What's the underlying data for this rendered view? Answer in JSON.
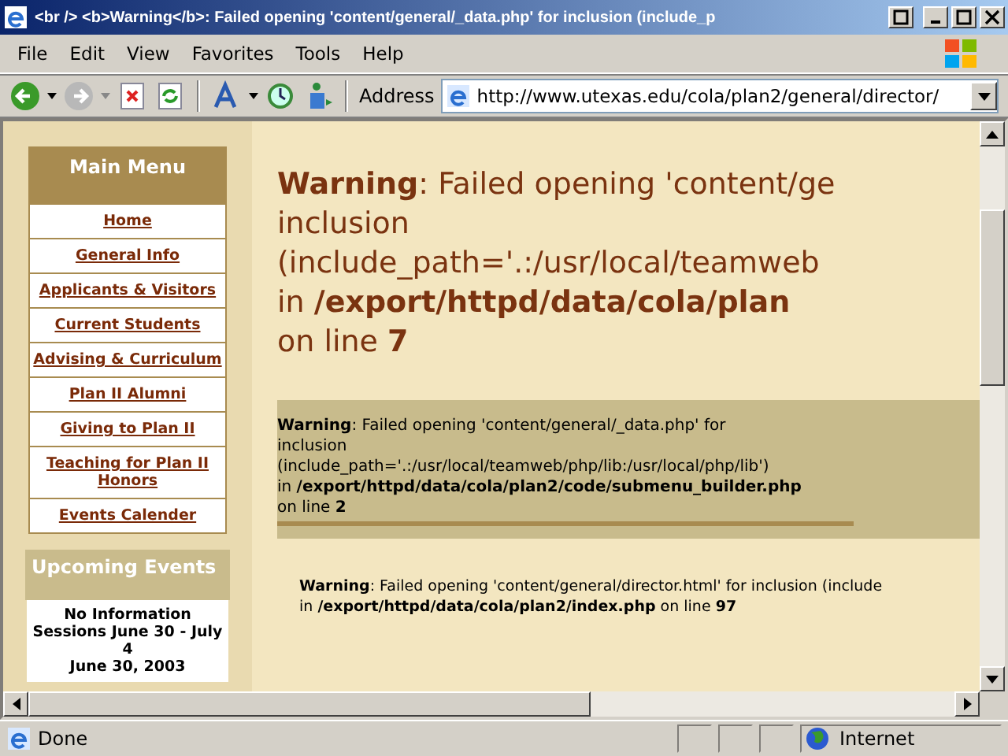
{
  "window": {
    "title": "<br /> <b>Warning</b>: Failed opening 'content/general/_data.php' for inclusion (include_p"
  },
  "menu": [
    "File",
    "Edit",
    "View",
    "Favorites",
    "Tools",
    "Help"
  ],
  "address": {
    "label": "Address",
    "value": "http://www.utexas.edu/cola/plan2/general/director/"
  },
  "sidebar": {
    "title": "Main Menu",
    "items": [
      "Home",
      "General Info",
      "Applicants & Visitors",
      "Current Students",
      "Advising & Curriculum",
      "Plan II Alumni",
      "Giving to Plan II",
      "Teaching for Plan II Honors",
      "Events Calender"
    ],
    "events_title": "Upcoming Events",
    "events": [
      "No Information Sessions June 30 - July 4",
      "June 30, 2003"
    ]
  },
  "warnings": [
    {
      "kind": "large",
      "lines": [
        "**Warning**: Failed opening 'content/ge",
        "inclusion",
        "(include_path='.:/usr/local/teamweb",
        "in **/export/httpd/data/cola/plan**",
        "on line **7**"
      ]
    },
    {
      "kind": "box",
      "lines": [
        "**Warning**: Failed opening 'content/general/_data.php' for",
        "inclusion",
        "(include_path='.:/usr/local/teamweb/php/lib:/usr/local/php/lib')",
        "in **/export/httpd/data/cola/plan2/code/submenu_builder.php**",
        "on line **2**"
      ]
    },
    {
      "kind": "small",
      "lines": [
        "**Warning**: Failed opening 'content/general/director.html' for inclusion (include",
        "in **/export/httpd/data/cola/plan2/index.php** on line **97**"
      ]
    }
  ],
  "status_bar": {
    "text": "Done",
    "zone": "Internet"
  }
}
